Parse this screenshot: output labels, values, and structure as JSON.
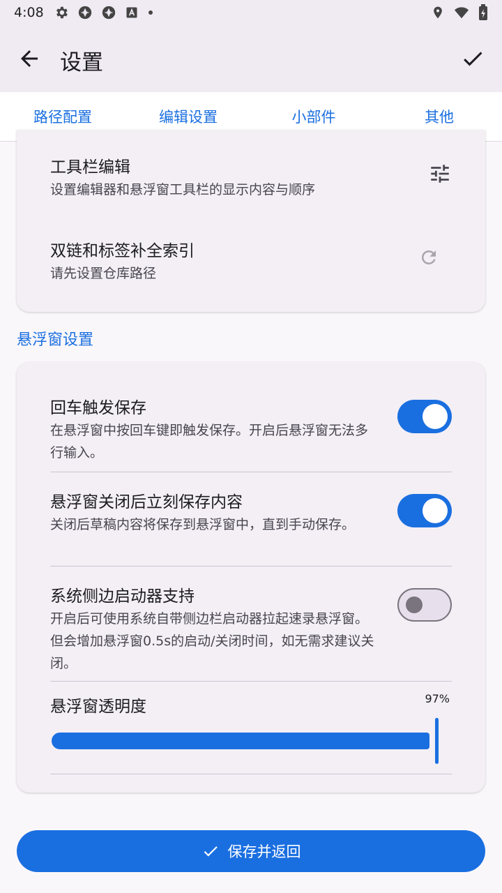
{
  "status_bar": {
    "time": "4:08",
    "icons": [
      "gear-icon",
      "app-icon",
      "app-icon",
      "a-box-icon",
      "dot-icon",
      "location-icon",
      "wifi-icon",
      "battery-icon"
    ]
  },
  "app_bar": {
    "title": "设置",
    "back_icon": "arrow-left-icon",
    "confirm_icon": "check-icon"
  },
  "tabs": [
    {
      "label": "路径配置",
      "active": false
    },
    {
      "label": "编辑设置",
      "active": true
    },
    {
      "label": "小部件",
      "active": false
    },
    {
      "label": "其他",
      "active": false
    }
  ],
  "editor_card": {
    "items": [
      {
        "title": "工具栏编辑",
        "desc": "设置编辑器和悬浮窗工具栏的显示内容与顺序",
        "icon": "tune-icon"
      },
      {
        "title": "双链和标签补全索引",
        "desc": "请先设置仓库路径",
        "icon": "refresh-icon"
      }
    ]
  },
  "floating_section": {
    "title": "悬浮窗设置",
    "items": [
      {
        "title": "回车触发保存",
        "desc": "在悬浮窗中按回车键即触发保存。开启后悬浮窗无法多行输入。",
        "enabled": true
      },
      {
        "title": "悬浮窗关闭后立刻保存内容",
        "desc": "关闭后草稿内容将保存到悬浮窗中，直到手动保存。",
        "enabled": true
      },
      {
        "title": "系统侧边启动器支持",
        "desc": "开启后可使用系统自带侧边栏启动器拉起速录悬浮窗。但会增加悬浮窗0.5s的启动/关闭时间，如无需求建议关闭。",
        "enabled": false
      }
    ],
    "opacity": {
      "title": "悬浮窗透明度",
      "value_label": "97%",
      "value": 0.97
    }
  },
  "save_button": {
    "label": "保存并返回",
    "icon": "check-icon"
  },
  "colors": {
    "accent": "#1a6fe0",
    "background": "#faf7fb",
    "app_bar": "#f0eaf2"
  }
}
